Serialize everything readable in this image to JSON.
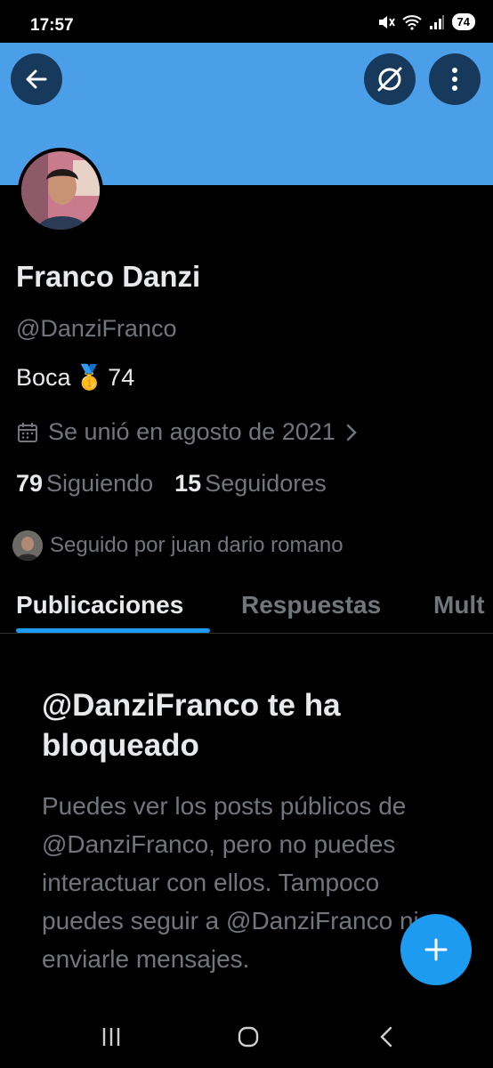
{
  "status_bar": {
    "time": "17:57",
    "battery": "74"
  },
  "profile": {
    "name": "Franco Danzi",
    "handle": "@DanziFranco",
    "bio_text": "Boca",
    "bio_emoji": "🥇",
    "bio_number": "74",
    "joined": "Se unió en agosto de 2021",
    "following_count": "79",
    "following_label": "Siguiendo",
    "followers_count": "15",
    "followers_label": "Seguidores",
    "followed_by": "Seguido por juan dario romano"
  },
  "tabs": [
    {
      "label": "Publicaciones",
      "active": true
    },
    {
      "label": "Respuestas",
      "active": false
    },
    {
      "label": "Mult",
      "active": false
    }
  ],
  "blocked_notice": {
    "title": "@DanziFranco te ha bloqueado",
    "body": "Puedes ver los posts públicos de @DanziFranco, pero no puedes interactuar con ellos. Tampoco puedes seguir a @DanziFranco ni enviarle mensajes."
  },
  "colors": {
    "banner": "#4b9fe9",
    "accent": "#1d9bf0",
    "muted": "#71767b"
  },
  "icons": {
    "back": "back-arrow-icon",
    "grok": "grok-icon",
    "more": "more-vertical-icon",
    "calendar": "calendar-icon",
    "fab": "plus-icon"
  }
}
